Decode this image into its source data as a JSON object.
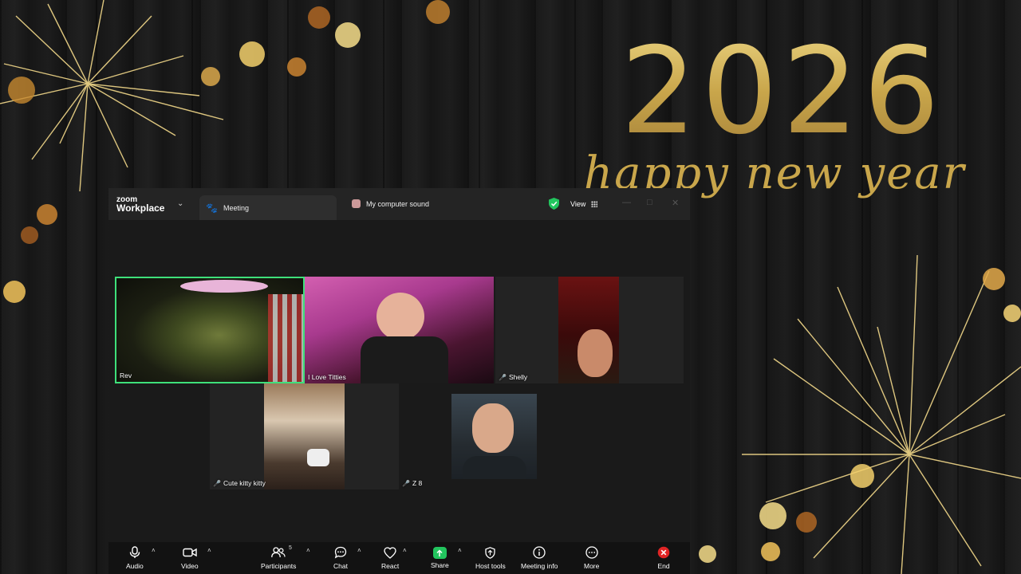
{
  "wallpaper": {
    "year": "2026",
    "greeting": "happy new year",
    "accent_color": "#c9a64b"
  },
  "window": {
    "brand_top": "zoom",
    "brand_bottom": "Workplace",
    "tabs": [
      {
        "label": "Meeting",
        "icon": "paw-icon"
      },
      {
        "label": "My computer sound",
        "icon": "sound-app-icon"
      }
    ],
    "view_label": "View",
    "security_color": "#22c55e"
  },
  "participants": [
    {
      "name": "Rev",
      "muted": false,
      "active_speaker": true
    },
    {
      "name": "I Love Titties",
      "muted": false
    },
    {
      "name": "Shelly",
      "muted": true
    },
    {
      "name": "Cute kitty kitty",
      "muted": true
    },
    {
      "name": "Z 8",
      "muted": true
    },
    {
      "name": "",
      "muted": false
    }
  ],
  "toolbar": {
    "audio": "Audio",
    "video": "Video",
    "participants": "Participants",
    "participants_count": "5",
    "chat": "Chat",
    "react": "React",
    "share": "Share",
    "host_tools": "Host tools",
    "meeting_info": "Meeting info",
    "more": "More",
    "end": "End",
    "share_color": "#22c55e",
    "end_color": "#e02424"
  }
}
